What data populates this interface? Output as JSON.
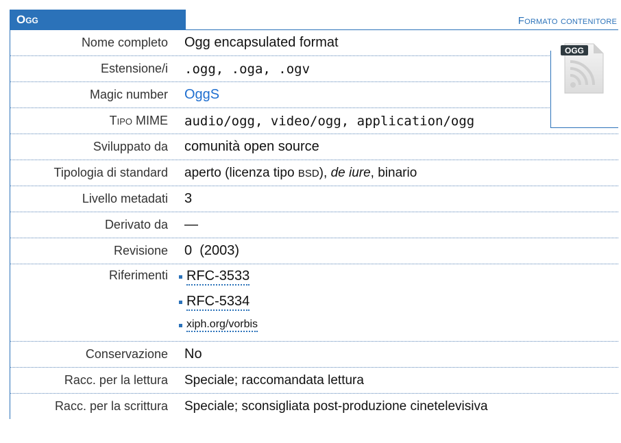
{
  "header": {
    "title": "Ogg",
    "category": "Formato contenitore"
  },
  "icon": {
    "name": "ogg-file-icon",
    "badge": "OGG"
  },
  "rows": [
    {
      "label": "Nome completo",
      "value": "Ogg encapsulated format"
    },
    {
      "label": "Estensione/i",
      "value": ".ogg, .oga, .ogv"
    },
    {
      "label": "Magic number",
      "value": "OggS"
    },
    {
      "label": "Tipo MIME",
      "value": "audio/ogg, video/ogg, application/ogg"
    },
    {
      "label": "Sviluppato da",
      "value": "comunità open source"
    },
    {
      "label": "Tipologia di standard",
      "value_pre": "aperto (licenza tipo ",
      "value_bsd": "BSD",
      "value_mid": "), ",
      "value_italic": "de iure",
      "value_post": ", binario"
    },
    {
      "label": "Livello metadati",
      "value": "3"
    },
    {
      "label": "Derivato da",
      "value": "—"
    },
    {
      "label": "Revisione",
      "value": "0  (2003)"
    },
    {
      "label": "Riferimenti",
      "refs": [
        "RFC-3533",
        "RFC-5334",
        "xiph.org/vorbis"
      ]
    },
    {
      "label": "Conservazione",
      "value": "No"
    },
    {
      "label": "Racc. per la lettura",
      "value": "Speciale; raccomandata lettura"
    },
    {
      "label": "Racc. per la scrittura",
      "value": "Speciale; sconsigliata post-produzione cinetelevisiva"
    }
  ],
  "colors": {
    "accent": "#2b72b9",
    "magic": "#1f6fd0"
  }
}
